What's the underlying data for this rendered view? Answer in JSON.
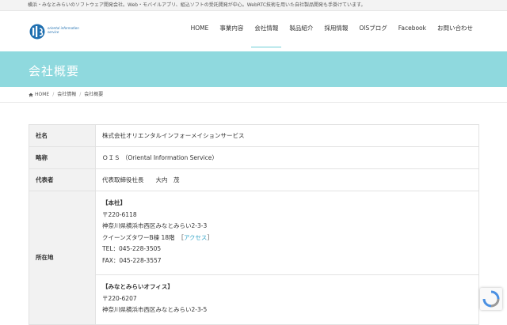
{
  "topbar": {
    "text": "横浜・みなとみらいのソフトウェア開発会社。Web・モバイルアプリ、組込ソフトの受託開発が中心。WebRTC技術を用いた自社製品開発も手掛けています。"
  },
  "logo": {
    "text": "oriental information service"
  },
  "nav": {
    "items": [
      "HOME",
      "事業内容",
      "会社情報",
      "製品紹介",
      "採用情報",
      "OISブログ",
      "Facebook",
      "お問い合わせ"
    ],
    "active": "会社情報"
  },
  "hero": {
    "title": "会社概要"
  },
  "breadcrumb": {
    "home": "HOME",
    "level1": "会社情報",
    "current": "会社概要"
  },
  "company": {
    "name_label": "社名",
    "name_value": "株式会社オリエンタルインフォーメイションサービス",
    "abbr_label": "略称",
    "abbr_value": "ＯＩＳ （Oriental Information Service）",
    "rep_label": "代表者",
    "rep_value": "代表取締役社長　　大内　茂",
    "addr_label": "所在地",
    "hq": {
      "title": "【本社】",
      "zip": "〒220-6118",
      "line1": "神奈川県横浜市西区みなとみらい2-3-3",
      "line2": "クイーンズタワーB棟 18階　",
      "access_open": "［",
      "access": "アクセス",
      "access_close": "］",
      "tel": "TEL：045-228-3505",
      "fax": "FAX：045-228-3557"
    },
    "mm": {
      "title": "【みなとみらいオフィス】",
      "zip": "〒220-6207",
      "line1": "神奈川県横浜市西区みなとみらい2-3-5"
    }
  },
  "colors": {
    "accent": "#8fd9de",
    "link": "#3aa7c9",
    "logo": "#1f6fb0"
  }
}
